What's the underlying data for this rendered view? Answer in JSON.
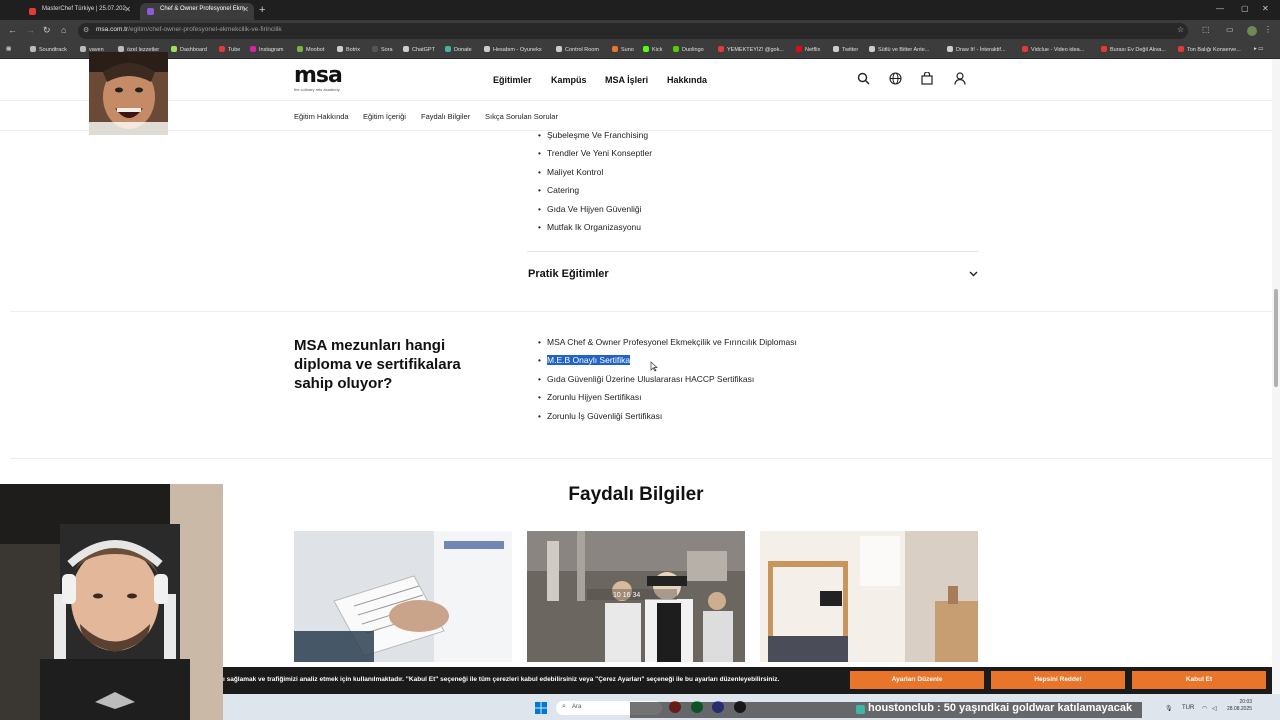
{
  "browser": {
    "tabs": [
      {
        "title": "MasterChef Türkiye | 25.07.202",
        "favicon_color": "#e53935"
      },
      {
        "title": "Chef & Owner Profesyonel Ekm",
        "favicon_color": "#8e5bd6"
      }
    ],
    "url_host": "msa.com.tr",
    "url_path": "/egitim/chef-owner-profesyonel-ekmekcilik-ve-firincilik",
    "bookmarks": [
      {
        "label": "Soundtrack",
        "color": "#888888"
      },
      {
        "label": "vaven",
        "color": "#888888"
      },
      {
        "label": "özel lezzetler",
        "color": "#888888"
      },
      {
        "label": "Dashboard",
        "color": "#9be15d"
      },
      {
        "label": "Tube",
        "color": "#e53935"
      },
      {
        "label": "Instagram",
        "color": "#d6249f"
      },
      {
        "label": "Moobot",
        "color": "#7cb342"
      },
      {
        "label": "Botrix",
        "color": "#cccccc"
      },
      {
        "label": "Sora",
        "color": "#555555"
      },
      {
        "label": "ChatGPT",
        "color": "#cccccc"
      },
      {
        "label": "Donate",
        "color": "#3fb5a5"
      },
      {
        "label": "Hesabım - Oyuneks",
        "color": "#cccccc"
      },
      {
        "label": "Control Room",
        "color": "#cccccc"
      },
      {
        "label": "Suno",
        "color": "#e8752a"
      },
      {
        "label": "Kick",
        "color": "#53fc18"
      },
      {
        "label": "Duolingo",
        "color": "#58cc02"
      },
      {
        "label": "YEMEKTEYİZ! @gok...",
        "color": "#e53935"
      },
      {
        "label": "Netflix",
        "color": "#e50914"
      },
      {
        "label": "Twitter",
        "color": "#cccccc"
      },
      {
        "label": "Sütlü ve Bitter Ante...",
        "color": "#cccccc"
      },
      {
        "label": "Draw It! - İnteraktif...",
        "color": "#cccccc"
      },
      {
        "label": "Vidclue - Video idea...",
        "color": "#e53935"
      },
      {
        "label": "Burası Ev Değil Akva...",
        "color": "#e53935"
      },
      {
        "label": "Ton Balığı Konserve...",
        "color": "#e53935"
      }
    ]
  },
  "site": {
    "logo": {
      "mark": "msa",
      "sub": "the culinary arts academy"
    },
    "nav": [
      "Eğitimler",
      "Kampüs",
      "MSA İşleri",
      "Hakkında"
    ],
    "subnav": [
      "Eğitim Hakkında",
      "Eğitim İçeriği",
      "Faydalı Bilgiler",
      "Sıkça Sorulan Sorular"
    ],
    "curriculum_items": [
      "Şubeleşme Ve Franchising",
      "Trendler Ve Yeni Konseptler",
      "Maliyet Kontrol",
      "Catering",
      "Gıda Ve Hijyen Güvenliği",
      "Mutfak Ik Organizasyonu"
    ],
    "accordion_title": "Pratik Eğitimler",
    "question": "MSA mezunları hangi diploma ve sertifikalara sahip oluyor?",
    "certificates": [
      "MSA Chef & Owner Profesyonel Ekmekçilik ve Fırıncılık Diploması",
      "M.E.B Onaylı Sertifika",
      "Gıda Güvenliği Üzerine Uluslararası HACCP Sertifikası",
      "Zorunlu Hijyen Sertifikası",
      "Zorunlu İş Güvenliği Sertifikası"
    ],
    "selected_certificate_index": 1,
    "useful_info_title": "Faydalı Bilgiler",
    "card_overlay_text": "10 16 34"
  },
  "cookie_banner": {
    "text": "ı sağlamak ve trafiğimizi analiz etmek için kullanılmaktadır. \"Kabul Et\" seçeneği ile tüm çerezleri kabul edebilirsiniz veya \"Çerez Ayarları\" seçeneği ile bu ayarları düzenleyebilirsiniz.",
    "buttons": [
      "Ayarları Düzenle",
      "Hepsini Reddet",
      "Kabul Et"
    ],
    "button_color": "#e8752a"
  },
  "taskbar": {
    "search_placeholder": "Ara",
    "stream_message": "houstonclub : 50 yaşındkai goldwar katılamayacak",
    "language": "TUR",
    "time": "20:03",
    "date": "28.08.2025"
  }
}
